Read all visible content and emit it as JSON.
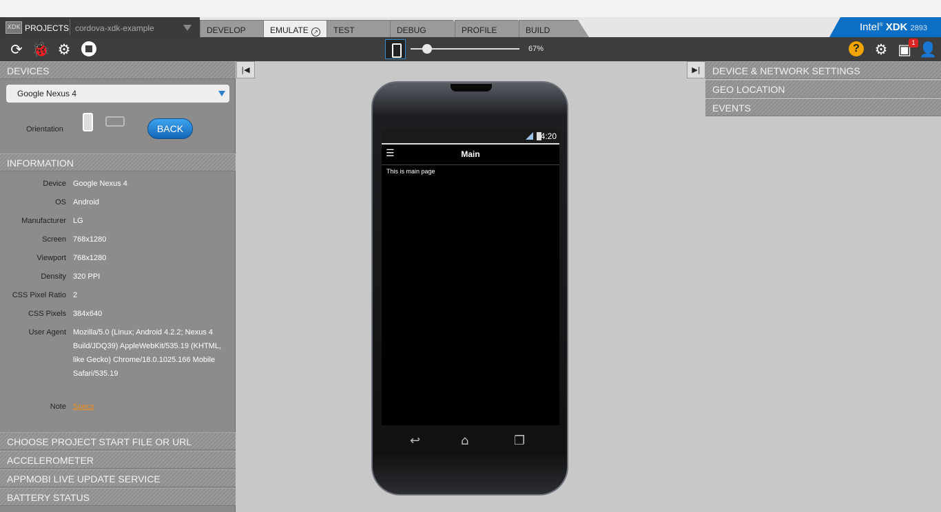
{
  "tabbar": {
    "logo_text": "XDK",
    "projects_label": "PROJECTS",
    "project_name": "cordova-xdk-example",
    "tabs": [
      {
        "label": "DEVELOP"
      },
      {
        "label": "EMULATE"
      },
      {
        "label": "TEST"
      },
      {
        "label": "DEBUG"
      },
      {
        "label": "PROFILE"
      },
      {
        "label": "BUILD"
      }
    ],
    "active_tab": "EMULATE",
    "brand": {
      "intel": "Intel",
      "xdk": "XDK",
      "version": "2893"
    }
  },
  "toolbar": {
    "icons": [
      "reload-icon",
      "debug-bug-icon",
      "debug-device-icon",
      "stop-icon",
      "device-frame-icon",
      "help-icon",
      "gear-icon",
      "notifications-icon",
      "user-icon"
    ],
    "zoom_value": "67%",
    "zoom_fraction": 0.15,
    "notification_count": "1",
    "accent": "#0b6fc5"
  },
  "left": {
    "devices_header": "DEVICES",
    "device_selected": "Google Nexus 4",
    "orientation_label": "Orientation",
    "back_label": "BACK",
    "information_header": "INFORMATION",
    "info": [
      {
        "key": "Device",
        "value": "Google Nexus 4"
      },
      {
        "key": "OS",
        "value": "Android"
      },
      {
        "key": "Manufacturer",
        "value": "LG"
      },
      {
        "key": "Screen",
        "value": "768x1280"
      },
      {
        "key": "Viewport",
        "value": "768x1280"
      },
      {
        "key": "Density",
        "value": "320 PPI"
      },
      {
        "key": "CSS Pixel Ratio",
        "value": "2"
      },
      {
        "key": "CSS Pixels",
        "value": "384x640"
      },
      {
        "key": "User Agent",
        "value": "Mozilla/5.0 (Linux; Android 4.2.2; Nexus 4 Build/JDQ39) AppleWebKit/535.19 (KHTML, like Gecko) Chrome/18.0.1025.166 Mobile Safari/535.19"
      }
    ],
    "note_key": "Note",
    "note_link": "Specs",
    "bottom_sections": [
      "CHOOSE PROJECT START FILE OR URL",
      "ACCELEROMETER",
      "APPMOBI LIVE UPDATE SERVICE",
      "BATTERY STATUS"
    ]
  },
  "right": {
    "sections": [
      "DEVICE & NETWORK SETTINGS",
      "GEO LOCATION",
      "EVENTS"
    ]
  },
  "phone": {
    "time": "4:20",
    "app_title": "Main",
    "page_text": "This is main page"
  }
}
